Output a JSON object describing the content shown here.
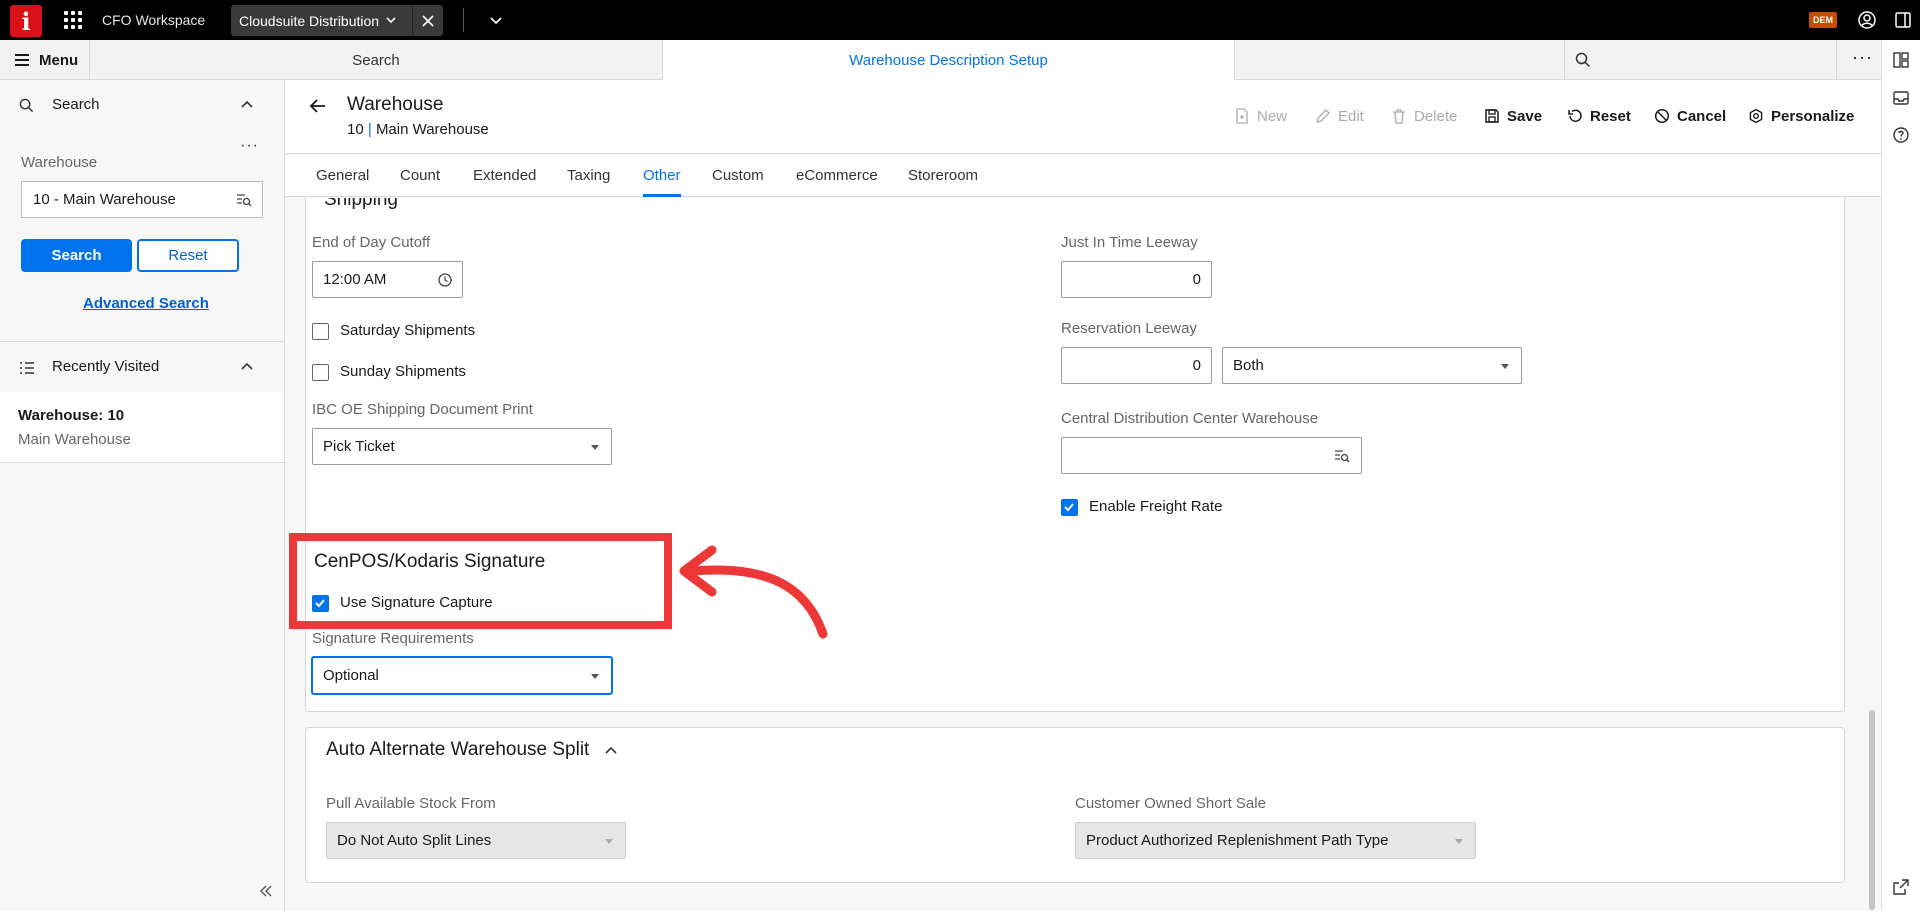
{
  "topbar": {
    "logo": "i",
    "workspace": "CFO Workspace",
    "open_tab": "Cloudsuite Distribution",
    "badge": "DEM"
  },
  "navbar": {
    "menu_label": "Menu",
    "search_tab": "Search",
    "active_tab": "Warehouse Description Setup"
  },
  "left_panel": {
    "search_title": "Search",
    "warehouse_label": "Warehouse",
    "warehouse_value": "10 - Main Warehouse",
    "search_button": "Search",
    "reset_button": "Reset",
    "advanced_search": "Advanced Search",
    "recent_title": "Recently Visited",
    "recent_items": [
      {
        "title": "Warehouse: 10",
        "subtitle": "Main Warehouse"
      }
    ]
  },
  "header": {
    "title": "Warehouse",
    "sub_id": "10",
    "sub_sep": "|",
    "sub_name": "Main Warehouse",
    "toolbar": {
      "new": "New",
      "edit": "Edit",
      "delete": "Delete",
      "save": "Save",
      "reset": "Reset",
      "cancel": "Cancel",
      "personalize": "Personalize"
    }
  },
  "tabs": [
    "General",
    "Count",
    "Extended",
    "Taxing",
    "Other",
    "Custom",
    "eCommerce",
    "Storeroom"
  ],
  "active_tab_index": 4,
  "shipping": {
    "partial_title": "Shipping",
    "end_of_day_label": "End of Day Cutoff",
    "end_of_day_value": "12:00 AM",
    "saturday_label": "Saturday Shipments",
    "saturday_checked": false,
    "sunday_label": "Sunday Shipments",
    "sunday_checked": false,
    "ibc_label": "IBC OE Shipping Document Print",
    "ibc_value": "Pick Ticket",
    "jit_label": "Just In Time Leeway",
    "jit_value": "0",
    "reservation_label": "Reservation Leeway",
    "reservation_value": "0",
    "reservation_type": "Both",
    "cdc_label": "Central Distribution Center Warehouse",
    "cdc_value": "",
    "freight_label": "Enable Freight Rate",
    "freight_checked": true
  },
  "signature": {
    "title": "CenPOS/Kodaris Signature",
    "use_capture_label": "Use Signature Capture",
    "use_capture_checked": true,
    "requirements_label": "Signature Requirements",
    "requirements_value": "Optional"
  },
  "auto_split": {
    "title": "Auto Alternate Warehouse Split",
    "pull_label": "Pull Available Stock From",
    "pull_value": "Do Not Auto Split Lines",
    "customer_label": "Customer Owned Short Sale",
    "customer_value": "Product Authorized Replenishment Path Type"
  },
  "colors": {
    "accent": "#0072ed",
    "annotation": "#ee3838",
    "brand": "#da1217"
  }
}
